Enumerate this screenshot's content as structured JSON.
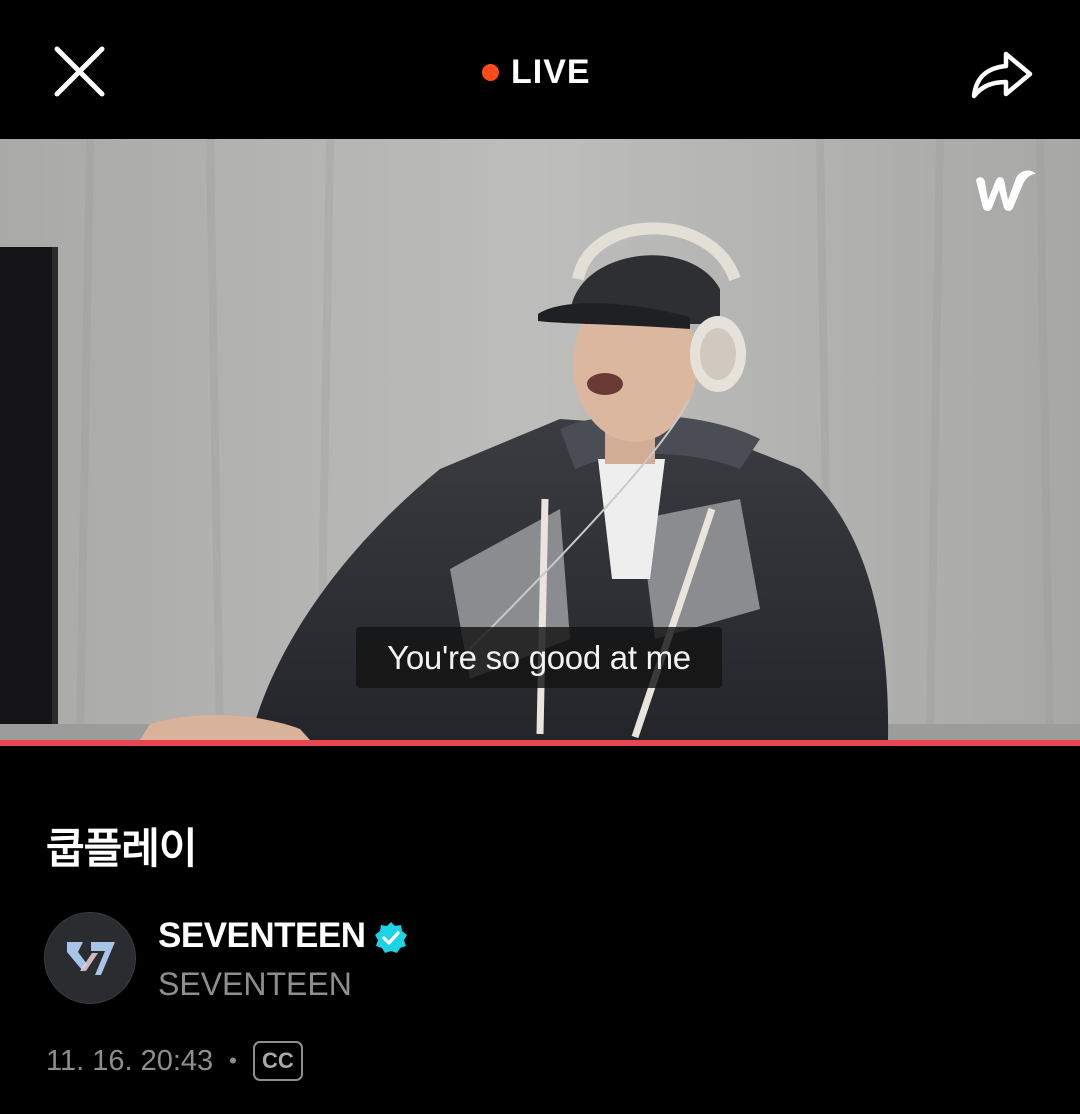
{
  "header": {
    "close_icon": "close-icon",
    "live_label": "LIVE",
    "share_icon": "share-icon"
  },
  "player": {
    "subtitle_text": "You're so good at me",
    "watermark_icon": "weverse-logo",
    "progress_fraction": 1.0
  },
  "video_title": "쿱플레이",
  "channel": {
    "name": "SEVENTEEN",
    "subname": "SEVENTEEN",
    "verified": true,
    "avatar_icon": "seventeen-logo"
  },
  "meta": {
    "timestamp": "11. 16. 20:43",
    "separator": "•",
    "cc_label": "CC"
  },
  "colors": {
    "live_dot": "#ff4a1c",
    "progress": "#e8454e",
    "verified": "#1ed3e6"
  }
}
